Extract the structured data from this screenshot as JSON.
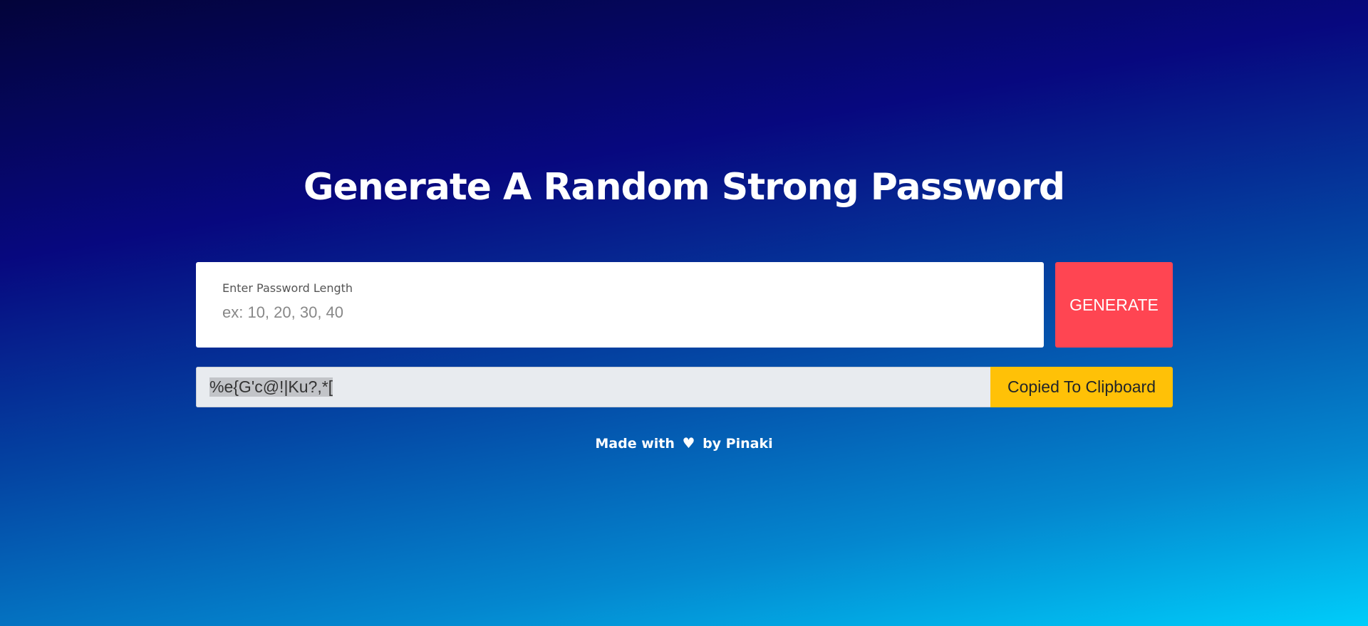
{
  "header": {
    "title": "Generate A Random Strong Password"
  },
  "length_field": {
    "label": "Enter Password Length",
    "placeholder": "ex: 10, 20, 30, 40",
    "value": ""
  },
  "generate_button": {
    "label": "GENERATE"
  },
  "result": {
    "password": "%e{G'c@!|Ku?,*[",
    "copy_label": "Copied To Clipboard"
  },
  "footer": {
    "made_with": "Made with",
    "heart_icon": "♥",
    "by": "by Pinaki"
  },
  "colors": {
    "generate": "#ff4552",
    "copy": "#ffc107",
    "background_top": "#03043a",
    "background_bottom": "#00cdfa"
  }
}
